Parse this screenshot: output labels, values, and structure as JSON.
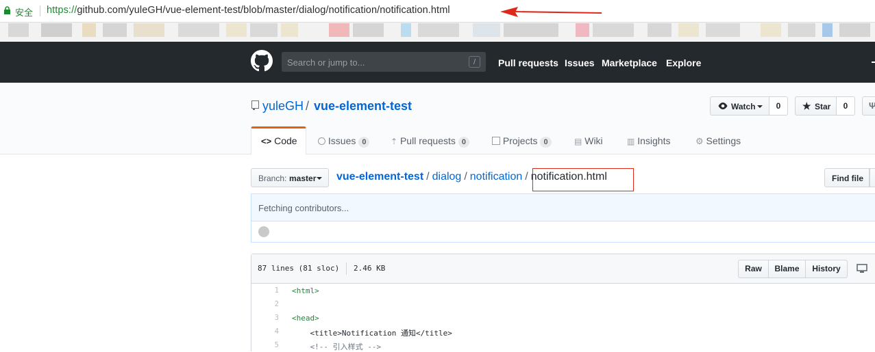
{
  "browser": {
    "secure_label": "安全",
    "url_scheme": "https://",
    "url_rest": "github.com/yuleGH/vue-element-test/blob/master/dialog/notification/notification.html"
  },
  "header": {
    "search_placeholder": "Search or jump to...",
    "search_key": "/",
    "nav": [
      "Pull requests",
      "Issues",
      "Marketplace",
      "Explore"
    ]
  },
  "repo": {
    "owner": "yuleGH",
    "separator": "/",
    "name": "vue-element-test",
    "watch_label": "Watch",
    "watch_count": "0",
    "star_label": "Star",
    "star_count": "0"
  },
  "tabs": [
    {
      "label": "Code"
    },
    {
      "label": "Issues",
      "count": "0"
    },
    {
      "label": "Pull requests",
      "count": "0"
    },
    {
      "label": "Projects",
      "count": "0"
    },
    {
      "label": "Wiki"
    },
    {
      "label": "Insights"
    },
    {
      "label": "Settings"
    }
  ],
  "file_nav": {
    "branch_prefix": "Branch:",
    "branch": "master",
    "crumbs": [
      "vue-element-test",
      "dialog",
      "notification"
    ],
    "filename": "notification.html",
    "find_file": "Find file"
  },
  "contributors": {
    "status": "Fetching contributors..."
  },
  "file": {
    "lines_info": "87 lines (81 sloc)",
    "size": "2.46 KB",
    "buttons": [
      "Raw",
      "Blame",
      "History"
    ],
    "lines": [
      {
        "n": "1",
        "text": "<html>"
      },
      {
        "n": "2",
        "text": ""
      },
      {
        "n": "3",
        "text": "<head>"
      },
      {
        "n": "4",
        "text": "    <title>Notification 通知</title>"
      },
      {
        "n": "5",
        "text": "    <!-- 引入样式 -->"
      }
    ]
  },
  "colors": {
    "header_bg": "#24292e",
    "link": "#0366d6",
    "active_tab": "#e36209",
    "annotation_red": "#e0281a"
  }
}
